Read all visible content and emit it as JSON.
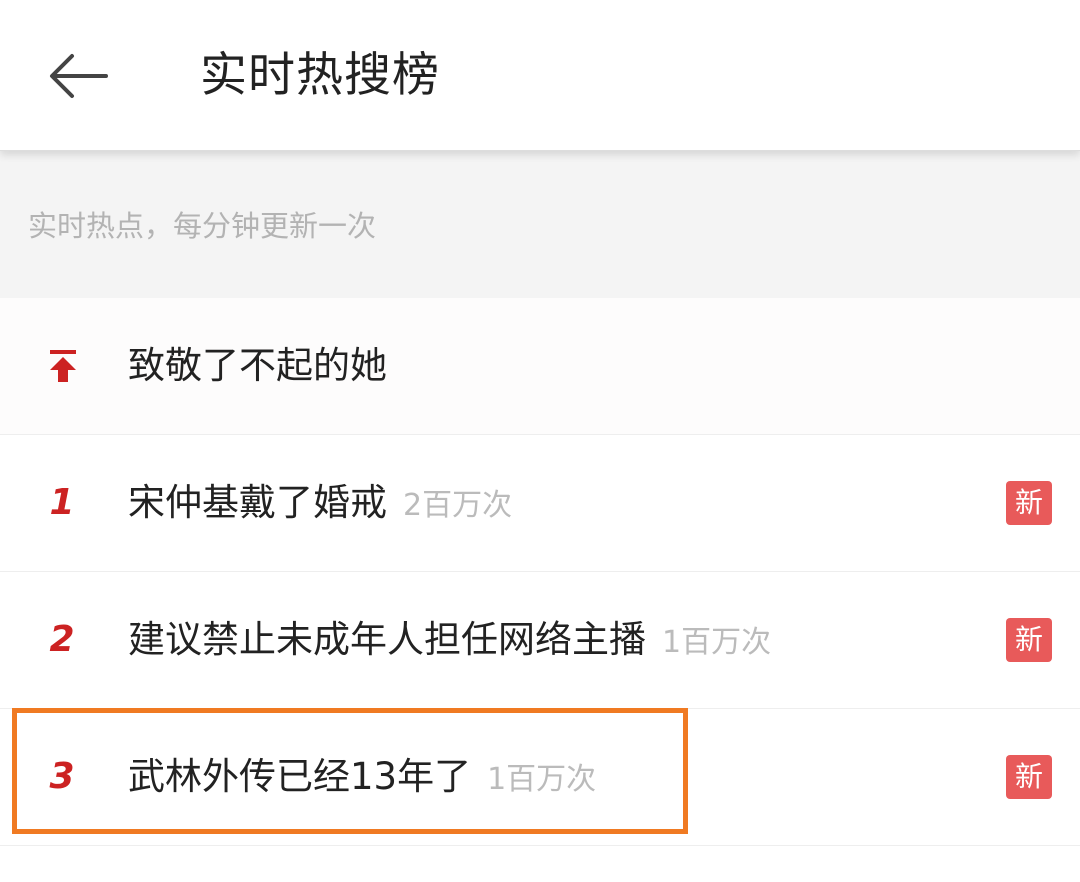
{
  "header": {
    "back_icon": "back-arrow-icon",
    "title": "实时热搜榜"
  },
  "subtitle": "实时热点，每分钟更新一次",
  "list": {
    "pinned": {
      "icon": "pin-to-top-icon",
      "title": "致敬了不起的她"
    },
    "items": [
      {
        "rank": "1",
        "title": "宋仲基戴了婚戒",
        "count": "2百万次",
        "badge": "新"
      },
      {
        "rank": "2",
        "title": "建议禁止未成年人担任网络主播",
        "count": "1百万次",
        "badge": "新"
      },
      {
        "rank": "3",
        "title": "武林外传已经13年了",
        "count": "1百万次",
        "badge": "新"
      }
    ]
  },
  "colors": {
    "rank_red": "#cc2222",
    "badge_red": "#e85a5a",
    "highlight_orange": "#f07a22"
  }
}
